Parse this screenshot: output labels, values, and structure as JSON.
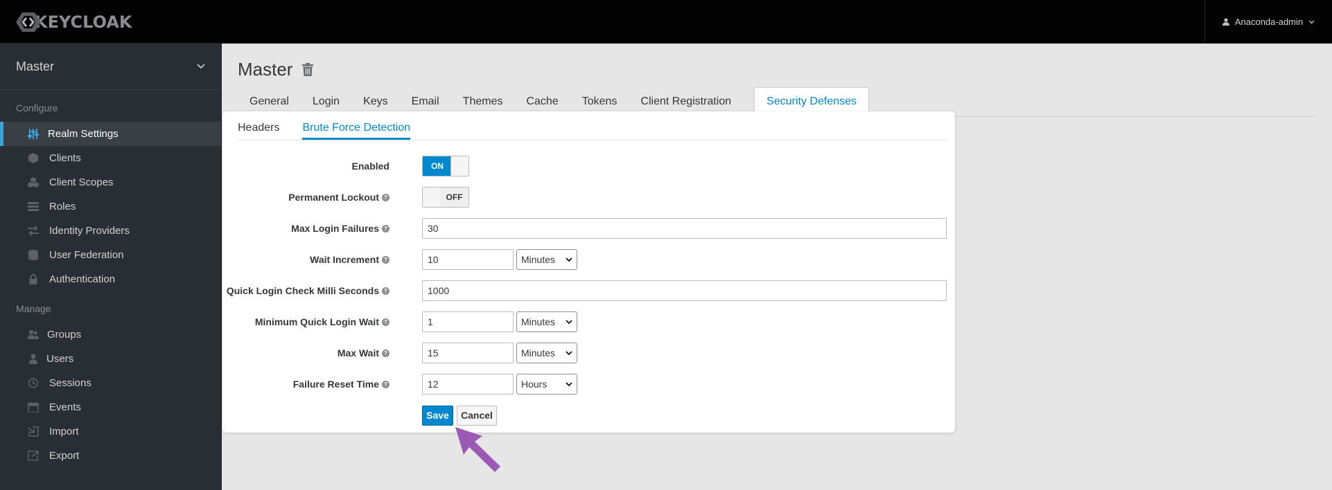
{
  "header": {
    "logo_text": "KEYCLOAK",
    "user_name": "Anaconda-admin"
  },
  "sidebar": {
    "realm": "Master",
    "sections": [
      {
        "title": "Configure",
        "items": [
          {
            "label": "Realm Settings",
            "icon": "sliders-icon",
            "active": true
          },
          {
            "label": "Clients",
            "icon": "cube-icon"
          },
          {
            "label": "Client Scopes",
            "icon": "cubes-icon"
          },
          {
            "label": "Roles",
            "icon": "list-icon"
          },
          {
            "label": "Identity Providers",
            "icon": "exchange-icon"
          },
          {
            "label": "User Federation",
            "icon": "database-icon"
          },
          {
            "label": "Authentication",
            "icon": "lock-icon"
          }
        ]
      },
      {
        "title": "Manage",
        "items": [
          {
            "label": "Groups",
            "icon": "users-icon"
          },
          {
            "label": "Users",
            "icon": "user-icon"
          },
          {
            "label": "Sessions",
            "icon": "clock-icon"
          },
          {
            "label": "Events",
            "icon": "calendar-icon"
          },
          {
            "label": "Import",
            "icon": "import-icon"
          },
          {
            "label": "Export",
            "icon": "export-icon"
          }
        ]
      }
    ]
  },
  "main": {
    "title": "Master",
    "tabs": [
      "General",
      "Login",
      "Keys",
      "Email",
      "Themes",
      "Cache",
      "Tokens",
      "Client Registration",
      "Security Defenses"
    ],
    "active_tab": "Security Defenses"
  },
  "panel": {
    "subtabs": [
      "Headers",
      "Brute Force Detection"
    ],
    "active_subtab": "Brute Force Detection",
    "fields": {
      "enabled": {
        "label": "Enabled",
        "value": "ON"
      },
      "permanent_lockout": {
        "label": "Permanent Lockout",
        "value": "OFF"
      },
      "max_login_failures": {
        "label": "Max Login Failures",
        "value": "30"
      },
      "wait_increment": {
        "label": "Wait Increment",
        "value": "10",
        "unit": "Minutes"
      },
      "quick_login_check": {
        "label": "Quick Login Check Milli Seconds",
        "value": "1000"
      },
      "min_quick_login_wait": {
        "label": "Minimum Quick Login Wait",
        "value": "1",
        "unit": "Minutes"
      },
      "max_wait": {
        "label": "Max Wait",
        "value": "15",
        "unit": "Minutes"
      },
      "failure_reset_time": {
        "label": "Failure Reset Time",
        "value": "12",
        "unit": "Hours"
      }
    },
    "help_glyph": "?",
    "save_label": "Save",
    "cancel_label": "Cancel"
  },
  "colors": {
    "accent": "#0088ce",
    "sidebar_bg": "#292e34",
    "topbar_bg": "#030303",
    "annotation_arrow": "#9b59b6"
  }
}
